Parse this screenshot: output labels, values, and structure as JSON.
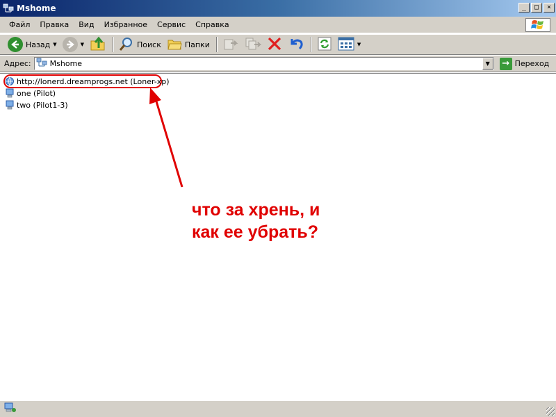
{
  "window": {
    "title": "Mshome"
  },
  "menu": [
    "Файл",
    "Правка",
    "Вид",
    "Избранное",
    "Сервис",
    "Справка"
  ],
  "toolbar": {
    "back_label": "Назад",
    "search_label": "Поиск",
    "folders_label": "Папки"
  },
  "address": {
    "label": "Адрес:",
    "value": "Mshome",
    "go_label": "Переход"
  },
  "items": [
    {
      "label": "http://lonerd.dreamprogs.net (Loner-xp)",
      "icon": "network-computer-icon"
    },
    {
      "label": "one (Pilot)",
      "icon": "computer-icon"
    },
    {
      "label": "two (Pilot1-3)",
      "icon": "computer-icon"
    }
  ],
  "annotation": {
    "line1": "что за хрень, и",
    "line2": "как ее убрать?",
    "color": "#e00000"
  },
  "colors": {
    "titlebar_start": "#0a246a",
    "chrome": "#d4d0c8",
    "annotation_red": "#e00000"
  }
}
